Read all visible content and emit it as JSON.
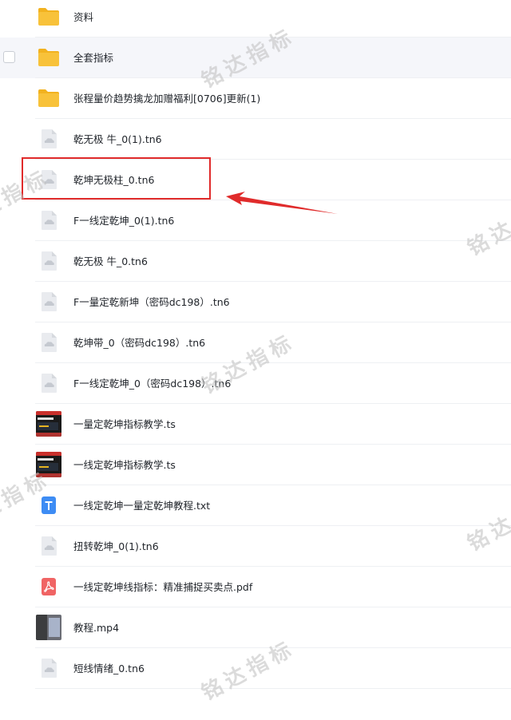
{
  "files": [
    {
      "name": "资料",
      "type": "folder"
    },
    {
      "name": "全套指标",
      "type": "folder",
      "hover": true
    },
    {
      "name": "张程量价趋势擒龙加赠福利[0706]更新(1)",
      "type": "folder"
    },
    {
      "name": "乾无极 牛_0(1).tn6",
      "type": "generic"
    },
    {
      "name": "乾坤无极柱_0.tn6",
      "type": "generic"
    },
    {
      "name": "F一线定乾坤_0(1).tn6",
      "type": "generic"
    },
    {
      "name": "乾无极 牛_0.tn6",
      "type": "generic"
    },
    {
      "name": "F一量定乾新坤（密码dc198）.tn6",
      "type": "generic"
    },
    {
      "name": "乾坤带_0（密码dc198）.tn6",
      "type": "generic"
    },
    {
      "name": "F一线定乾坤_0（密码dc198）.tn6",
      "type": "generic"
    },
    {
      "name": "一量定乾坤指标教学.ts",
      "type": "video-thumb"
    },
    {
      "name": "一线定乾坤指标教学.ts",
      "type": "video-thumb"
    },
    {
      "name": "一线定乾坤一量定乾坤教程.txt",
      "type": "txt"
    },
    {
      "name": "扭转乾坤_0(1).tn6",
      "type": "generic"
    },
    {
      "name": "一线定乾坤线指标：精准捕捉买卖点.pdf",
      "type": "pdf"
    },
    {
      "name": "教程.mp4",
      "type": "mp4-thumb"
    },
    {
      "name": "短线情绪_0.tn6",
      "type": "generic"
    }
  ],
  "watermark": "铭达指标",
  "colors": {
    "folder": "#f8c23a",
    "folder_tab": "#f2b21f",
    "generic_icon": "#e9ebef",
    "cloud": "#c5c9d0",
    "txt": "#3d8cf4",
    "pdf": "#f06464",
    "highlight": "#e02b2b"
  }
}
